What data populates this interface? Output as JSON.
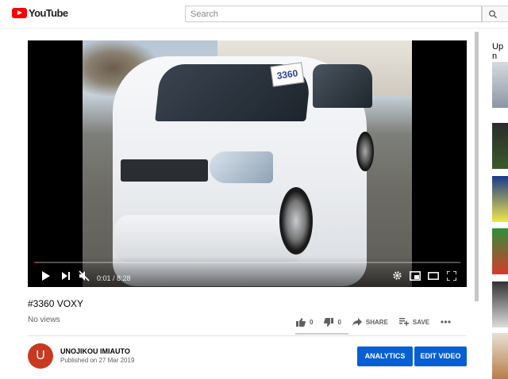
{
  "masthead": {
    "logo_text": "YouTube",
    "search_placeholder": "Search"
  },
  "player": {
    "price_tag": "3360",
    "time_current": "0:01",
    "time_total": "8:28",
    "time_display": "0:01 / 8:28",
    "progress_fraction": 0.002
  },
  "video": {
    "title": "#3360 VOXY",
    "views": "No views",
    "likes": "0",
    "dislikes": "0",
    "share_label": "SHARE",
    "save_label": "SAVE"
  },
  "channel": {
    "avatar_letter": "U",
    "name": "UNOJIKOU IMIAUTO",
    "published": "Published on 27 Mar 2019",
    "analytics_label": "ANALYTICS",
    "edit_label": "EDIT VIDEO"
  },
  "sidebar": {
    "up_next_label": "Up n"
  },
  "colors": {
    "brand_red": "#ff0000",
    "action_blue": "#065fd4",
    "avatar": "#c73a20"
  }
}
